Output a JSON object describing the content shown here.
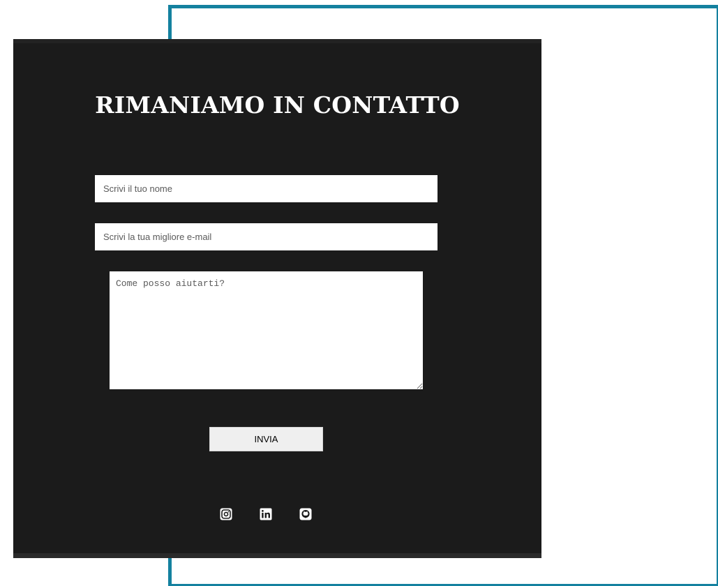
{
  "contact": {
    "title": "RIMANIAMO IN CONTATTO",
    "name_placeholder": "Scrivi il tuo nome",
    "email_placeholder": "Scrivi la tua migliore e-mail",
    "message_placeholder": "Come posso aiutarti?",
    "submit_label": "INVIA"
  },
  "socials": [
    {
      "icon": "instagram-icon"
    },
    {
      "icon": "linkedin-icon"
    },
    {
      "icon": "github-icon"
    }
  ],
  "colors": {
    "frame_border": "#14819f",
    "panel_background": "#1b1b1b",
    "button_background": "#efefef"
  }
}
